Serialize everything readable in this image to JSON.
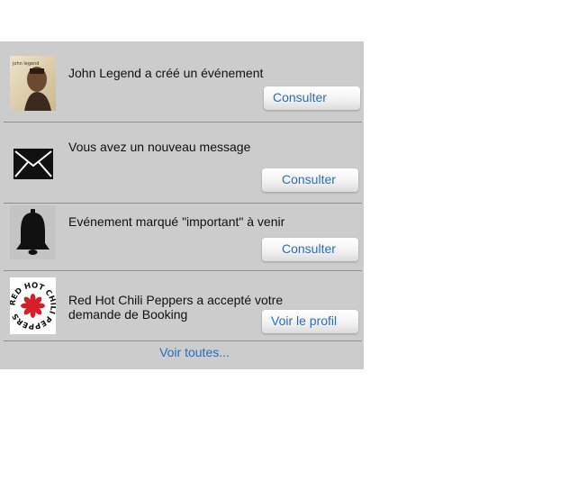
{
  "notifications": [
    {
      "text": "John Legend a créé un événement",
      "button": "Consulter",
      "thumbnail": "john-legend-album-cover",
      "thumb_text": "john legend"
    },
    {
      "text": "Vous avez un nouveau message",
      "button": "Consulter",
      "thumbnail": "envelope-icon"
    },
    {
      "text": "Evénement marqué \"important\" à venir",
      "button": "Consulter",
      "thumbnail": "bell-icon"
    },
    {
      "text": "Red Hot Chili Peppers a accepté votre demande de Booking",
      "button": "Voir le profil",
      "thumbnail": "red-hot-chili-peppers-logo",
      "thumb_text": "RED HOT CHILI PEPPERS"
    }
  ],
  "footer": {
    "see_all": "Voir toutes..."
  },
  "colors": {
    "panel_bg": "#cccccc",
    "link": "#2a6ebb",
    "separator": "#8f8f8f"
  }
}
